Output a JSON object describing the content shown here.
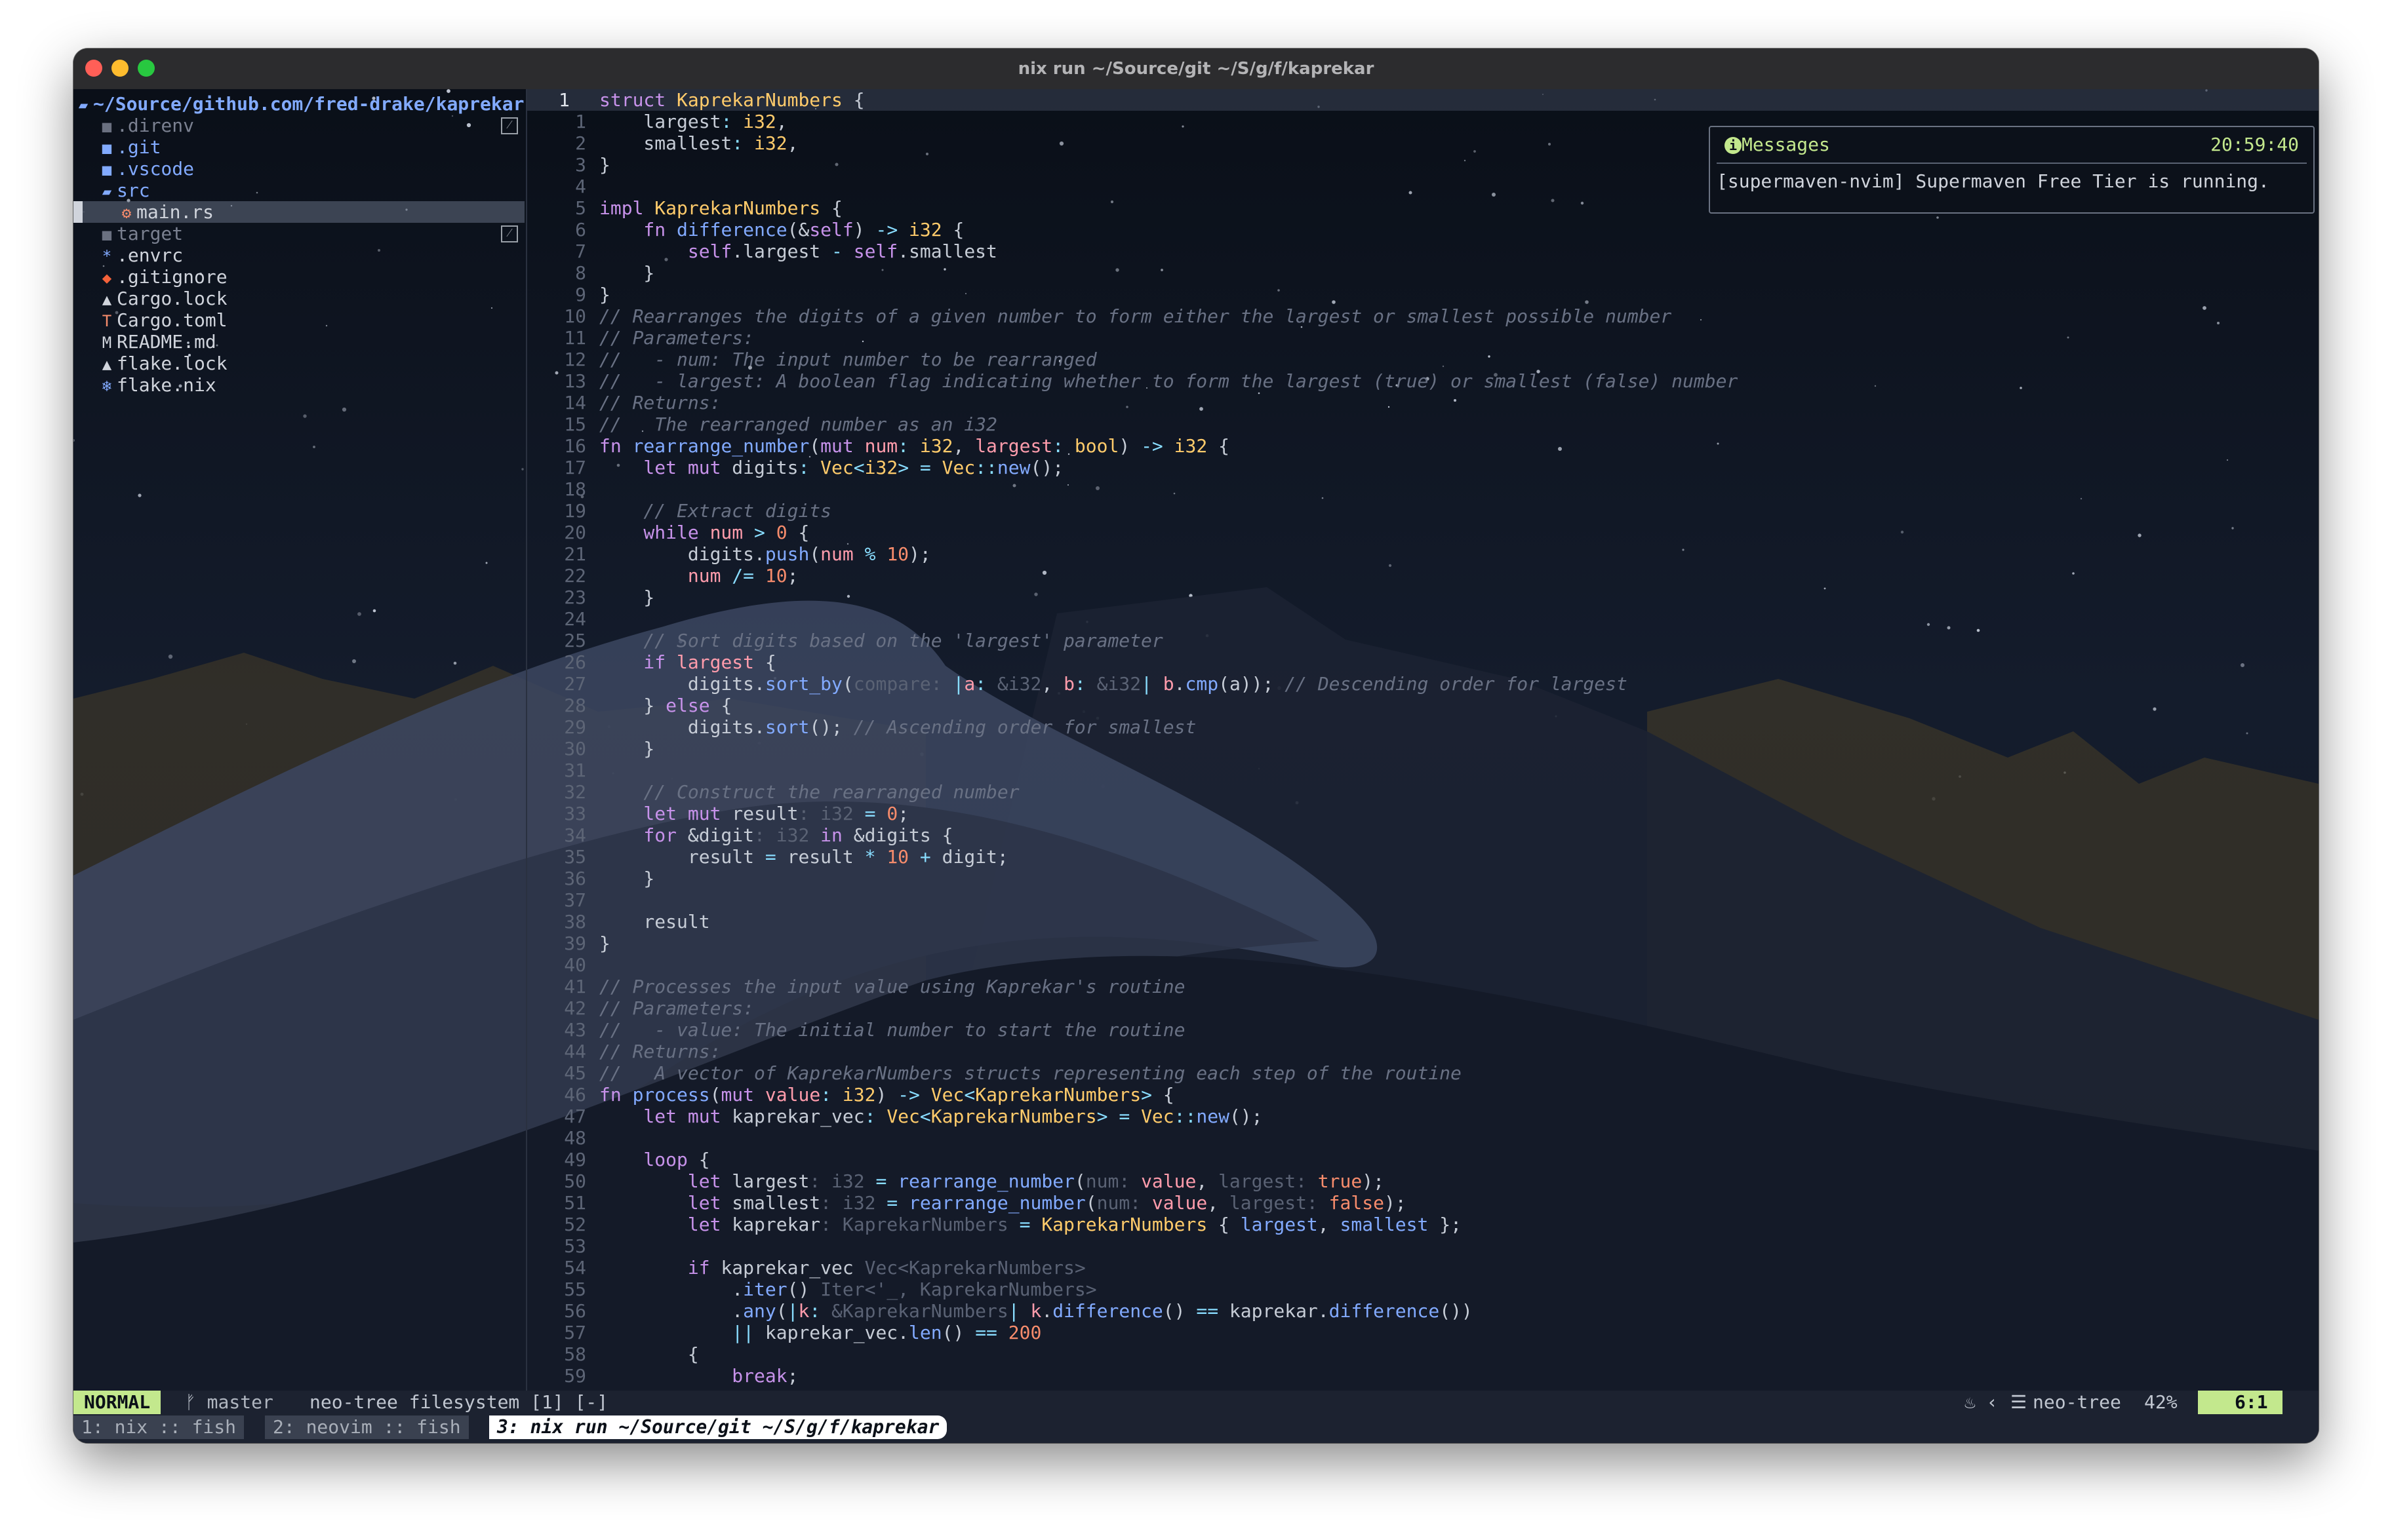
{
  "window": {
    "title": "nix run ~/Source/git ~/S/g/f/kaprekar"
  },
  "tree": {
    "root": "~/Source/github.com/fred-drake/kaprekar",
    "items": [
      {
        "name": ".direnv",
        "icon": "folder-icon",
        "ignored": true
      },
      {
        "name": ".git",
        "icon": "folder-icon"
      },
      {
        "name": ".vscode",
        "icon": "folder-icon"
      },
      {
        "name": "src",
        "icon": "folder-open-icon"
      },
      {
        "name": "main.rs",
        "icon": "rust-icon",
        "selected": true
      },
      {
        "name": "target",
        "icon": "folder-icon",
        "ignored": true
      },
      {
        "name": ".envrc",
        "icon": "asterisk-icon"
      },
      {
        "name": ".gitignore",
        "icon": "git-icon"
      },
      {
        "name": "Cargo.lock",
        "icon": "lock-icon"
      },
      {
        "name": "Cargo.toml",
        "icon": "toml-icon"
      },
      {
        "name": "README.md",
        "icon": "markdown-icon"
      },
      {
        "name": "flake.lock",
        "icon": "lock-icon"
      },
      {
        "name": "flake.nix",
        "icon": "nix-icon"
      }
    ]
  },
  "editor": {
    "current_line": "1",
    "lines": [
      [
        [
          "kw",
          "struct "
        ],
        [
          "ty",
          "KaprekarNumbers"
        ],
        [
          "id",
          " {"
        ]
      ],
      [
        [
          "id",
          "    largest"
        ],
        [
          "op",
          ": "
        ],
        [
          "ty",
          "i32"
        ],
        [
          "id",
          ","
        ]
      ],
      [
        [
          "id",
          "    smallest"
        ],
        [
          "op",
          ": "
        ],
        [
          "ty",
          "i32"
        ],
        [
          "id",
          ","
        ]
      ],
      [
        [
          "id",
          "}"
        ]
      ],
      [],
      [
        [
          "kw",
          "impl "
        ],
        [
          "ty",
          "KaprekarNumbers"
        ],
        [
          "id",
          " {"
        ]
      ],
      [
        [
          "kw",
          "    fn "
        ],
        [
          "fn",
          "difference"
        ],
        [
          "id",
          "(&"
        ],
        [
          "kw",
          "self"
        ],
        [
          "id",
          ") "
        ],
        [
          "op",
          "-> "
        ],
        [
          "ty",
          "i32"
        ],
        [
          "id",
          " {"
        ]
      ],
      [
        [
          "kw",
          "        self"
        ],
        [
          "id",
          ".largest "
        ],
        [
          "op",
          "- "
        ],
        [
          "kw",
          "self"
        ],
        [
          "id",
          ".smallest"
        ]
      ],
      [
        [
          "id",
          "    }"
        ]
      ],
      [
        [
          "id",
          "}"
        ]
      ],
      [
        [
          "cm",
          "// Rearranges the digits of a given number to form either the largest or smallest possible number"
        ]
      ],
      [
        [
          "cm",
          "// Parameters:"
        ]
      ],
      [
        [
          "cm",
          "//   - num: The input number to be rearranged"
        ]
      ],
      [
        [
          "cm",
          "//   - largest: A boolean flag indicating whether to form the largest (true) or smallest (false) number"
        ]
      ],
      [
        [
          "cm",
          "// Returns:"
        ]
      ],
      [
        [
          "cm",
          "//   The rearranged number as an i32"
        ]
      ],
      [
        [
          "kw",
          "fn "
        ],
        [
          "fn",
          "rearrange_number"
        ],
        [
          "id",
          "("
        ],
        [
          "kw",
          "mut "
        ],
        [
          "bo",
          "num"
        ],
        [
          "op",
          ": "
        ],
        [
          "ty",
          "i32"
        ],
        [
          "id",
          ", "
        ],
        [
          "bo",
          "largest"
        ],
        [
          "op",
          ": "
        ],
        [
          "ty",
          "bool"
        ],
        [
          "id",
          ") "
        ],
        [
          "op",
          "-> "
        ],
        [
          "ty",
          "i32"
        ],
        [
          "id",
          " {"
        ]
      ],
      [
        [
          "kw",
          "    let mut "
        ],
        [
          "id",
          "digits"
        ],
        [
          "op",
          ": "
        ],
        [
          "ty",
          "Vec"
        ],
        [
          "op",
          "<"
        ],
        [
          "ty",
          "i32"
        ],
        [
          "op",
          "> = "
        ],
        [
          "ty",
          "Vec"
        ],
        [
          "op",
          "::"
        ],
        [
          "fn",
          "new"
        ],
        [
          "id",
          "();"
        ]
      ],
      [],
      [
        [
          "cm",
          "    // Extract digits"
        ]
      ],
      [
        [
          "kw",
          "    while "
        ],
        [
          "bo",
          "num"
        ],
        [
          "op",
          " > "
        ],
        [
          "nm",
          "0"
        ],
        [
          "id",
          " {"
        ]
      ],
      [
        [
          "id",
          "        digits."
        ],
        [
          "fn",
          "push"
        ],
        [
          "id",
          "("
        ],
        [
          "bo",
          "num"
        ],
        [
          "op",
          " % "
        ],
        [
          "nm",
          "10"
        ],
        [
          "id",
          ");"
        ]
      ],
      [
        [
          "bo",
          "        num"
        ],
        [
          "op",
          " /= "
        ],
        [
          "nm",
          "10"
        ],
        [
          "id",
          ";"
        ]
      ],
      [
        [
          "id",
          "    }"
        ]
      ],
      [],
      [
        [
          "cm",
          "    // Sort digits based on the 'largest' parameter"
        ]
      ],
      [
        [
          "kw",
          "    if "
        ],
        [
          "bo",
          "largest"
        ],
        [
          "id",
          " {"
        ]
      ],
      [
        [
          "id",
          "        digits."
        ],
        [
          "fn",
          "sort_by"
        ],
        [
          "id",
          "("
        ],
        [
          "hint",
          "compare: "
        ],
        [
          "op",
          "|"
        ],
        [
          "bo",
          "a"
        ],
        [
          "op",
          ": "
        ],
        [
          "hint",
          "&i32"
        ],
        [
          "id",
          ", "
        ],
        [
          "bo",
          "b"
        ],
        [
          "op",
          ": "
        ],
        [
          "hint",
          "&i32"
        ],
        [
          "op",
          "| "
        ],
        [
          "bo",
          "b"
        ],
        [
          "id",
          "."
        ],
        [
          "fn",
          "cmp"
        ],
        [
          "id",
          "(a)); "
        ],
        [
          "cm",
          "// Descending order for largest"
        ]
      ],
      [
        [
          "id",
          "    } "
        ],
        [
          "kw",
          "else"
        ],
        [
          "id",
          " {"
        ]
      ],
      [
        [
          "id",
          "        digits."
        ],
        [
          "fn",
          "sort"
        ],
        [
          "id",
          "(); "
        ],
        [
          "cm",
          "// Ascending order for smallest"
        ]
      ],
      [
        [
          "id",
          "    }"
        ]
      ],
      [],
      [
        [
          "cm",
          "    // Construct the rearranged number"
        ]
      ],
      [
        [
          "kw",
          "    let mut "
        ],
        [
          "id",
          "result"
        ],
        [
          "hint",
          ": i32"
        ],
        [
          "op",
          " = "
        ],
        [
          "nm",
          "0"
        ],
        [
          "id",
          ";"
        ]
      ],
      [
        [
          "kw",
          "    for "
        ],
        [
          "id",
          "&digit"
        ],
        [
          "hint",
          ": i32"
        ],
        [
          "kw",
          " in "
        ],
        [
          "id",
          "&digits {"
        ]
      ],
      [
        [
          "id",
          "        result "
        ],
        [
          "op",
          "= "
        ],
        [
          "id",
          "result "
        ],
        [
          "op",
          "* "
        ],
        [
          "nm",
          "10"
        ],
        [
          "op",
          " + "
        ],
        [
          "id",
          "digit;"
        ]
      ],
      [
        [
          "id",
          "    }"
        ]
      ],
      [],
      [
        [
          "id",
          "    result"
        ]
      ],
      [
        [
          "id",
          "}"
        ]
      ],
      [],
      [
        [
          "cm",
          "// Processes the input value using Kaprekar's routine"
        ]
      ],
      [
        [
          "cm",
          "// Parameters:"
        ]
      ],
      [
        [
          "cm",
          "//   - value: The initial number to start the routine"
        ]
      ],
      [
        [
          "cm",
          "// Returns:"
        ]
      ],
      [
        [
          "cm",
          "//   A vector of KaprekarNumbers structs representing each step of the routine"
        ]
      ],
      [
        [
          "kw",
          "fn "
        ],
        [
          "fn",
          "process"
        ],
        [
          "id",
          "("
        ],
        [
          "kw",
          "mut "
        ],
        [
          "bo",
          "value"
        ],
        [
          "op",
          ": "
        ],
        [
          "ty",
          "i32"
        ],
        [
          "id",
          ") "
        ],
        [
          "op",
          "-> "
        ],
        [
          "ty",
          "Vec"
        ],
        [
          "op",
          "<"
        ],
        [
          "ty",
          "KaprekarNumbers"
        ],
        [
          "op",
          "> "
        ],
        [
          "id",
          "{"
        ]
      ],
      [
        [
          "kw",
          "    let mut "
        ],
        [
          "id",
          "kaprekar_vec"
        ],
        [
          "op",
          ": "
        ],
        [
          "ty",
          "Vec"
        ],
        [
          "op",
          "<"
        ],
        [
          "ty",
          "KaprekarNumbers"
        ],
        [
          "op",
          "> = "
        ],
        [
          "ty",
          "Vec"
        ],
        [
          "op",
          "::"
        ],
        [
          "fn",
          "new"
        ],
        [
          "id",
          "();"
        ]
      ],
      [],
      [
        [
          "kw",
          "    loop"
        ],
        [
          "id",
          " {"
        ]
      ],
      [
        [
          "kw",
          "        let "
        ],
        [
          "id",
          "largest"
        ],
        [
          "hint",
          ": i32"
        ],
        [
          "op",
          " = "
        ],
        [
          "fn",
          "rearrange_number"
        ],
        [
          "id",
          "("
        ],
        [
          "hint",
          "num: "
        ],
        [
          "bo",
          "value"
        ],
        [
          "id",
          ", "
        ],
        [
          "hint",
          "largest: "
        ],
        [
          "nm",
          "true"
        ],
        [
          "id",
          ");"
        ]
      ],
      [
        [
          "kw",
          "        let "
        ],
        [
          "id",
          "smallest"
        ],
        [
          "hint",
          ": i32"
        ],
        [
          "op",
          " = "
        ],
        [
          "fn",
          "rearrange_number"
        ],
        [
          "id",
          "("
        ],
        [
          "hint",
          "num: "
        ],
        [
          "bo",
          "value"
        ],
        [
          "id",
          ", "
        ],
        [
          "hint",
          "largest: "
        ],
        [
          "nm",
          "false"
        ],
        [
          "id",
          ");"
        ]
      ],
      [
        [
          "kw",
          "        let "
        ],
        [
          "id",
          "kaprekar"
        ],
        [
          "hint",
          ": KaprekarNumbers"
        ],
        [
          "op",
          " = "
        ],
        [
          "ty",
          "KaprekarNumbers"
        ],
        [
          "id",
          " { "
        ],
        [
          "fn",
          "largest"
        ],
        [
          "id",
          ", "
        ],
        [
          "fn",
          "smallest"
        ],
        [
          "id",
          " };"
        ]
      ],
      [],
      [
        [
          "kw",
          "        if "
        ],
        [
          "id",
          "kaprekar_vec "
        ],
        [
          "hint",
          "Vec<KaprekarNumbers>"
        ]
      ],
      [
        [
          "id",
          "            ."
        ],
        [
          "fn",
          "iter"
        ],
        [
          "id",
          "() "
        ],
        [
          "hint",
          "Iter<'_, KaprekarNumbers>"
        ]
      ],
      [
        [
          "id",
          "            ."
        ],
        [
          "fn",
          "any"
        ],
        [
          "id",
          "("
        ],
        [
          "op",
          "|"
        ],
        [
          "bo",
          "k"
        ],
        [
          "op",
          ": "
        ],
        [
          "hint",
          "&KaprekarNumbers"
        ],
        [
          "op",
          "| "
        ],
        [
          "bo",
          "k"
        ],
        [
          "id",
          "."
        ],
        [
          "fn",
          "difference"
        ],
        [
          "id",
          "() "
        ],
        [
          "op",
          "== "
        ],
        [
          "id",
          "kaprekar."
        ],
        [
          "fn",
          "difference"
        ],
        [
          "id",
          "())"
        ]
      ],
      [
        [
          "op",
          "            || "
        ],
        [
          "id",
          "kaprekar_vec."
        ],
        [
          "fn",
          "len"
        ],
        [
          "id",
          "() "
        ],
        [
          "op",
          "== "
        ],
        [
          "nm",
          "200"
        ]
      ],
      [
        [
          "id",
          "        {"
        ]
      ],
      [
        [
          "kw",
          "            break"
        ],
        [
          "id",
          ";"
        ]
      ]
    ]
  },
  "messages": {
    "title": "Messages",
    "time": "20:59:40",
    "text": "[supermaven-nvim] Supermaven Free Tier is running."
  },
  "statusline": {
    "mode": "NORMAL",
    "branch": "master",
    "file": "neo-tree filesystem [1] [-]",
    "filetype": "neo-tree",
    "percent": "42%",
    "position": "6:1"
  },
  "tmux": {
    "windows": [
      {
        "label": "1: nix :: fish"
      },
      {
        "label": "2: neovim :: fish"
      },
      {
        "label": "3: nix run ~/Source/git ~/S/g/f/kaprekar",
        "active": true
      }
    ]
  },
  "colors": {
    "accent": "#c3e88d",
    "folder": "#82aaff",
    "background": "#0b1018"
  }
}
